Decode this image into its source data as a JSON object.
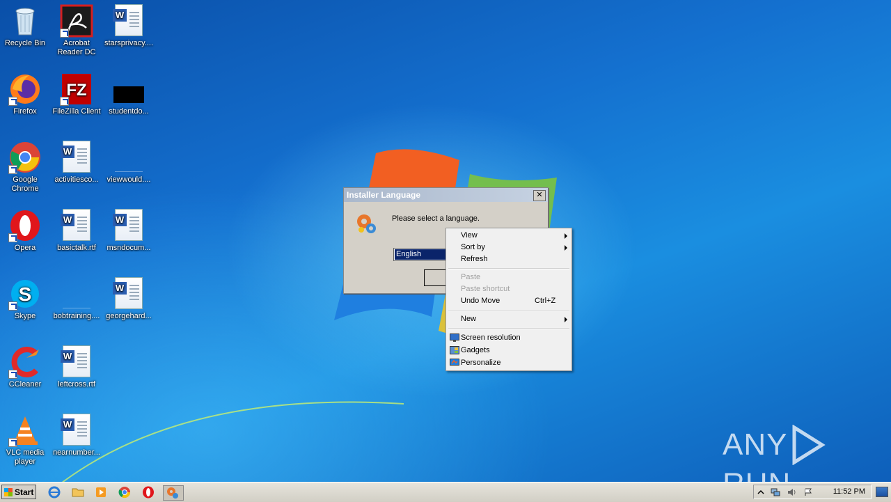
{
  "desktop": {
    "icons": [
      {
        "label": "Recycle Bin"
      },
      {
        "label": "Acrobat Reader DC"
      },
      {
        "label": "starsprivacy...."
      },
      {
        "label": "Firefox"
      },
      {
        "label": "FileZilla Client"
      },
      {
        "label": "studentdo..."
      },
      {
        "label": "Google Chrome"
      },
      {
        "label": "activitiesco..."
      },
      {
        "label": "viewwould...."
      },
      {
        "label": "Opera"
      },
      {
        "label": "basictalk.rtf"
      },
      {
        "label": "msndocum..."
      },
      {
        "label": "Skype"
      },
      {
        "label": "bobtraining...."
      },
      {
        "label": "georgehard..."
      },
      {
        "label": "CCleaner"
      },
      {
        "label": "leftcross.rtf"
      },
      {
        "label": "VLC media player"
      },
      {
        "label": "nearnumber..."
      }
    ]
  },
  "dialog": {
    "title": "Installer Language",
    "close_label": "✕",
    "prompt": "Please select a language.",
    "selected_language": "English"
  },
  "context_menu": {
    "items": [
      {
        "label": "View"
      },
      {
        "label": "Sort by"
      },
      {
        "label": "Refresh"
      },
      {
        "label": "Paste"
      },
      {
        "label": "Paste shortcut"
      },
      {
        "label": "Undo Move",
        "shortcut": "Ctrl+Z"
      },
      {
        "label": "New"
      },
      {
        "label": "Screen resolution"
      },
      {
        "label": "Gadgets"
      },
      {
        "label": "Personalize"
      }
    ]
  },
  "taskbar": {
    "start_label": "Start",
    "clock": "11:52 PM"
  },
  "watermark": {
    "left": "ANY",
    "right": "RUN"
  },
  "colors": {
    "menu_bg": "#f0f0f0",
    "selection": "#0a246a",
    "taskbar": "#d4d0c8"
  }
}
